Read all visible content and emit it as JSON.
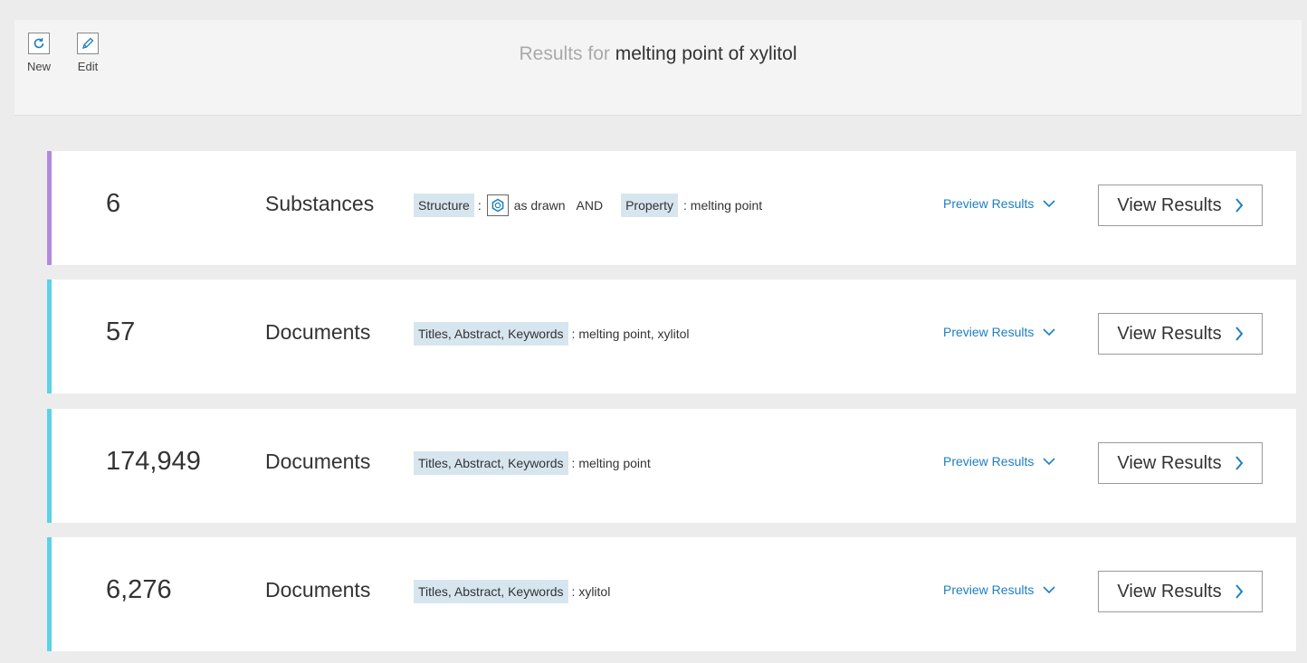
{
  "toolbar": {
    "new_label": "New",
    "edit_label": "Edit"
  },
  "header": {
    "prefix": "Results for",
    "query": "melting point of xylitol"
  },
  "rows": [
    {
      "count": "6",
      "kind": "Substances",
      "accent": "#b18ae0",
      "chip1": "Structure",
      "structure_text": "as drawn",
      "and": "AND",
      "chip2": "Property",
      "value": ": melting point",
      "preview": "Preview Results",
      "view": "View Results"
    },
    {
      "count": "57",
      "kind": "Documents",
      "accent": "#5bd2e6",
      "chip1": "Titles, Abstract, Keywords",
      "value": ": melting point, xylitol",
      "preview": "Preview Results",
      "view": "View Results"
    },
    {
      "count": "174,949",
      "kind": "Documents",
      "accent": "#5bd2e6",
      "chip1": "Titles, Abstract, Keywords",
      "value": ": melting point",
      "preview": "Preview Results",
      "view": "View Results"
    },
    {
      "count": "6,276",
      "kind": "Documents",
      "accent": "#5bd2e6",
      "chip1": "Titles, Abstract, Keywords",
      "value": ": xylitol",
      "preview": "Preview Results",
      "view": "View Results"
    }
  ],
  "colors": {
    "link": "#1d7ec2",
    "chip_bg": "#d7e5ef"
  }
}
